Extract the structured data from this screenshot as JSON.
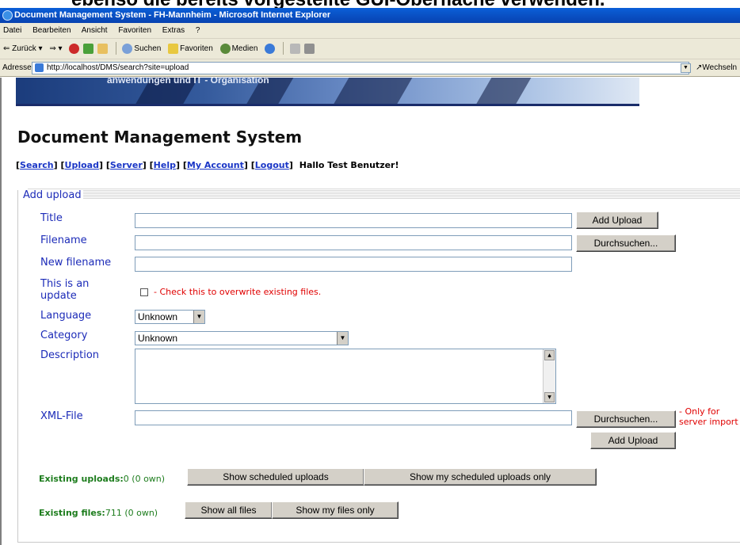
{
  "slide": {
    "heading": "ebenso die bereits vorgestellte GUI-Oberfläche verwenden."
  },
  "window": {
    "title": "Document Management System - FH-Mannheim - Microsoft Internet Explorer"
  },
  "menu": [
    "Datei",
    "Bearbeiten",
    "Ansicht",
    "Favoriten",
    "Extras",
    "?"
  ],
  "toolbar": {
    "back": "Zurück",
    "search": "Suchen",
    "favorites": "Favoriten",
    "media": "Medien"
  },
  "address": {
    "label": "Adresse",
    "url": "http://localhost/DMS/search?site=upload",
    "go": "Wechseln"
  },
  "banner": {
    "text": "anwendungen und IT - Organisation"
  },
  "page": {
    "title": "Document Management System",
    "nav": {
      "search": "Search",
      "upload": "Upload",
      "server": "Server",
      "help": "Help",
      "account": "My Account",
      "logout": "Logout",
      "greeting": "Hallo Test Benutzer!"
    }
  },
  "form": {
    "legend": "Add upload",
    "title_label": "Title",
    "title_value": "",
    "add_upload": "Add Upload",
    "filename_label": "Filename",
    "filename_value": "",
    "browse": "Durchsuchen...",
    "new_filename_label": "New filename",
    "new_filename_value": "",
    "update_label": "This is an update",
    "update_note": "- Check this to overwrite existing files.",
    "language_label": "Language",
    "language_value": "Unknown",
    "category_label": "Category",
    "category_value": "Unknown",
    "description_label": "Description",
    "xml_label": "XML-File",
    "xml_value": "",
    "xml_note_1": "- Only for",
    "xml_note_2": "server import",
    "add_upload_bottom": "Add Upload"
  },
  "stats": {
    "uploads_label": "Existing uploads:",
    "uploads_value": "0 (0 own)",
    "show_scheduled": "Show scheduled uploads",
    "show_my_scheduled": "Show my scheduled uploads only",
    "files_label": "Existing files:",
    "files_value": "711 (0 own)",
    "show_all": "Show all files",
    "show_mine": "Show my files only"
  }
}
